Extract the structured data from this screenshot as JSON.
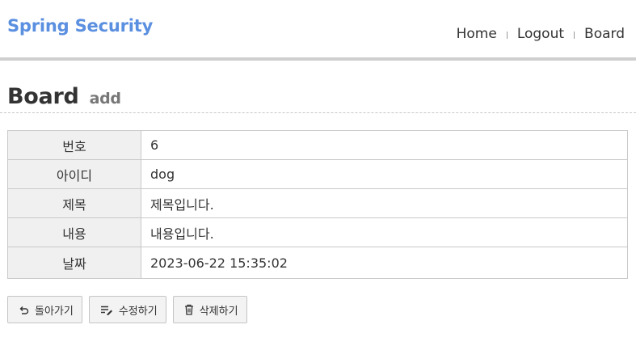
{
  "header": {
    "brand": "Spring Security",
    "nav": [
      {
        "label": "Home"
      },
      {
        "label": "Logout"
      },
      {
        "label": "Board"
      }
    ]
  },
  "page": {
    "title": "Board",
    "subtitle": "add"
  },
  "detail": {
    "rows": [
      {
        "label": "번호",
        "value": "6"
      },
      {
        "label": "아이디",
        "value": "dog"
      },
      {
        "label": "제목",
        "value": "제목입니다."
      },
      {
        "label": "내용",
        "value": "내용입니다."
      },
      {
        "label": "날짜",
        "value": "2023-06-22 15:35:02"
      }
    ]
  },
  "actions": {
    "back": {
      "label": "돌아가기",
      "icon": "undo-icon"
    },
    "edit": {
      "label": "수정하기",
      "icon": "edit-list-icon"
    },
    "delete": {
      "label": "삭제하기",
      "icon": "trash-icon"
    }
  },
  "colors": {
    "brand": "#5b8fe0",
    "header_rule": "#cfcfcf",
    "label_bg": "#f0f0f0"
  }
}
